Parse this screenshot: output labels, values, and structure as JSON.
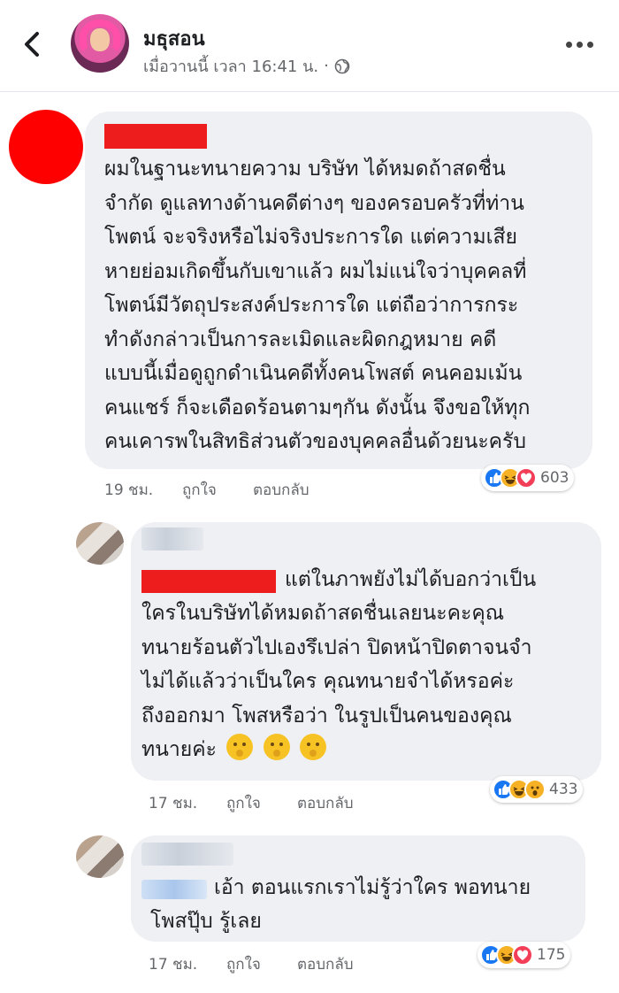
{
  "header": {
    "page_name": "มธุสอน",
    "post_time": "เมื่อวานนี้ เวลา 16:41 น.",
    "separator": "·",
    "back_icon": "back-arrow-icon",
    "more_icon": "more-options-icon",
    "audience_icon": "globe-icon"
  },
  "comments": [
    {
      "lines": [
        "ผมในฐานะทนายความ บริษัท ได้หมดถ้าสดชื่น",
        "จำกัด ดูแลทางด้านคดีต่างๆ ของครอบครัวที่ท่าน",
        "โพตน์ จะจริงหรือไม่จริงประการใด แต่ความเสีย",
        "หายย่อมเกิดขึ้นกับเขาแล้ว ผมไม่แน่ใจว่าบุคคลที่",
        "โพตน์มีวัตถุประสงค์ประการใด แต่ถือว่าการกระ",
        "ทำดังกล่าวเป็นการละเมิดและผิดกฎหมาย คดี",
        "แบบนี้เมื่อดูถูกดำเนินคดีทั้งคนโพสต์ คนคอมเม้น",
        "คนแชร์ ก็จะเดือดร้อนตามๆกัน ดังนั้น จึงขอให้ทุก",
        "คนเคารพในสิทธิส่วนตัวของบุคคลอื่นด้วยนะครับ"
      ],
      "time": "19 ชม.",
      "like": "ถูกใจ",
      "reply": "ตอบกลับ",
      "reaction_count": "603",
      "reactions": [
        "like-icon",
        "haha-icon",
        "love-icon"
      ]
    },
    {
      "first_line": "แต่ในภาพยังไม่ได้บอกว่าเป็น",
      "lines": [
        "ใครในบริษัทได้หมดถ้าสดชื่นเลยนะคะคุณ",
        "ทนายร้อนตัวไปเองรึเปล่า ปิดหน้าปิดตาจนจำ",
        "ไม่ได้แล้วว่าเป็นใคร คุณทนายจำได้หรอค่ะ",
        "ถึงออกมา โพสหรือว่า ในรูปเป็นคนของคุณ"
      ],
      "last_line": "ทนายค่ะ",
      "emojis": [
        "shushing-face-icon",
        "shushing-face-icon",
        "shushing-face-icon"
      ],
      "time": "17 ชม.",
      "like": "ถูกใจ",
      "reply": "ตอบกลับ",
      "reaction_count": "433",
      "reactions": [
        "like-icon",
        "haha-icon",
        "wow-icon"
      ]
    },
    {
      "first_line": "เอ้า ตอนแรกเราไม่รู้ว่าใคร พอทนาย",
      "lines": [
        "โพสปุ๊บ รู้เลย"
      ],
      "time": "17 ชม.",
      "like": "ถูกใจ",
      "reply": "ตอบกลับ",
      "reaction_count": "175",
      "reactions": [
        "like-icon",
        "haha-icon",
        "love-icon"
      ]
    }
  ],
  "colors": {
    "bubble": "#eef0f3",
    "redaction": "#ee1d1d",
    "muted_text": "#65676b",
    "like": "#1877f2",
    "love": "#f33e58",
    "haha": "#f7b125"
  }
}
